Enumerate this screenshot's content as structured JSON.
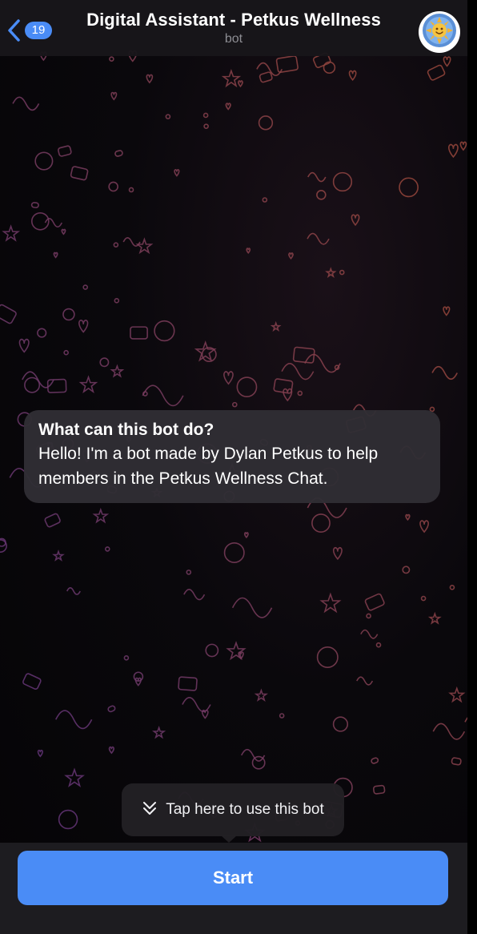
{
  "header": {
    "back_count": "19",
    "title": "Digital Assistant - Petkus Wellness",
    "subtitle": "bot",
    "avatar_icon": "sun-avatar-icon"
  },
  "intro": {
    "title": "What can this bot do?",
    "body": "Hello! I'm a bot made by Dylan Petkus to help members in the Petkus Wellness Chat."
  },
  "tooltip": {
    "icon": "double-chevron-down-icon",
    "text": "Tap here to use this bot"
  },
  "bottom": {
    "start_label": "Start"
  },
  "colors": {
    "accent": "#4a8cf6",
    "background": "#000000",
    "bubble": "#302e34"
  }
}
